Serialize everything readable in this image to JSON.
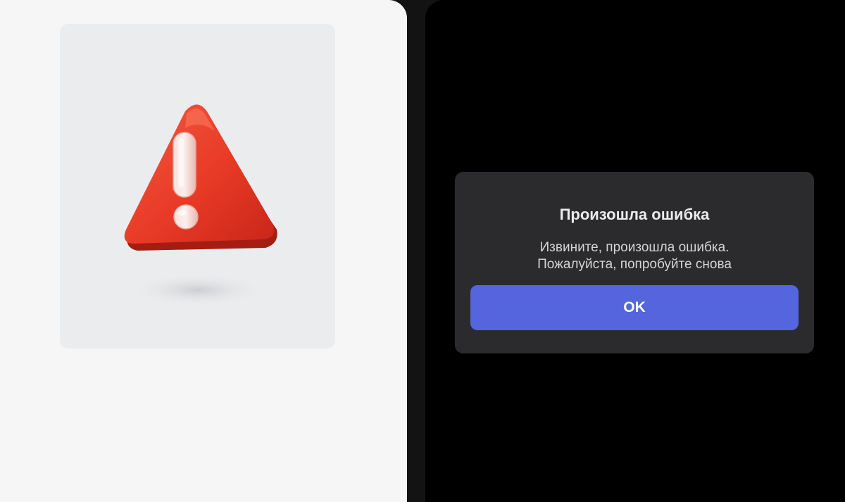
{
  "illustration": {
    "icon": "warning-triangle-icon",
    "colors": {
      "card_background": "#ebecee",
      "triangle": "#e83a26",
      "exclamation": "#f2d2cf"
    }
  },
  "dialog": {
    "title": "Произошла ошибка",
    "message_lines": [
      "Извините, произошла ошибка.",
      "Пожалуйста, попробуйте снова"
    ],
    "ok_label": "OK",
    "colors": {
      "background": "#2b2b2d",
      "button": "#5565dd"
    }
  },
  "theme": {
    "left_background": "#f6f6f6",
    "right_background": "#000000"
  }
}
